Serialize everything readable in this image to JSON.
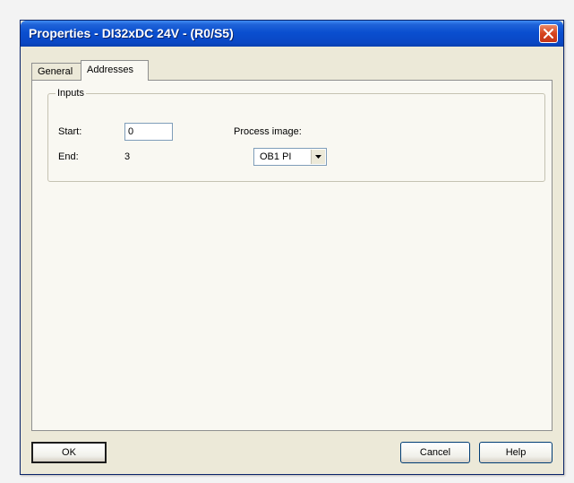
{
  "window": {
    "title": "Properties - DI32xDC 24V - (R0/S5)",
    "close_icon": "close-icon"
  },
  "tabs": [
    {
      "label": "General",
      "active": false
    },
    {
      "label": "Addresses",
      "active": true
    }
  ],
  "inputs_group": {
    "label": "Inputs",
    "start_label": "Start:",
    "start_value": "0",
    "end_label": "End:",
    "end_value": "3",
    "process_image_label": "Process image:",
    "process_image_value": "OB1 PI",
    "dropdown_icon": "chevron-down-icon"
  },
  "buttons": {
    "ok": "OK",
    "cancel": "Cancel",
    "help": "Help"
  },
  "colors": {
    "titlebar": "#0a4fd0",
    "dialog_bg": "#ece9d8",
    "panel_bg": "#f9f8f2",
    "close_button": "#d6431c"
  }
}
